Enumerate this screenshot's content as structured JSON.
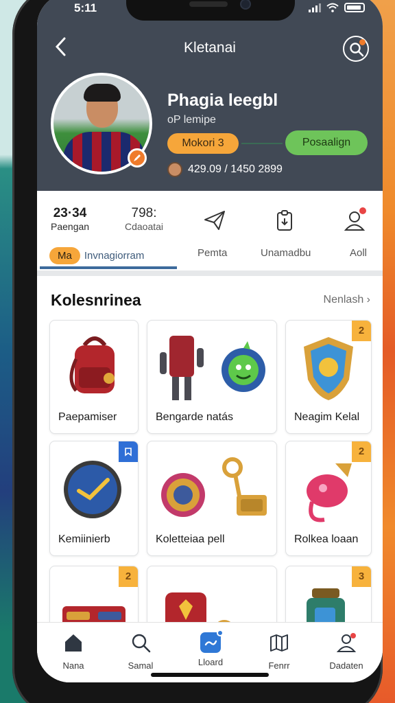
{
  "status": {
    "time": "5:11"
  },
  "header": {
    "title": "Kletanai",
    "back_icon": "chevron-left-icon",
    "search_icon": "search-icon"
  },
  "profile": {
    "name": "Phagia leegbl",
    "subtitle": "oP lemipe",
    "level": "Mokori 3",
    "action": "Posaalign",
    "stats": "429.09 / 1450 2899"
  },
  "top_stats": [
    {
      "num": "23·34",
      "label": "Paengan"
    },
    {
      "num": "798:",
      "label": "Cdaoatai"
    }
  ],
  "tabs": {
    "active_badge": "Ma",
    "active": "Invnagiorram",
    "items": [
      "Pemta",
      "Unamadbu",
      "Aoll"
    ]
  },
  "section": {
    "title": "Kolesnrinea",
    "see_all": "Nenlash"
  },
  "items": [
    {
      "label": "Paepamiser",
      "badge": ""
    },
    {
      "label": "Bengarde natás",
      "badge": ""
    },
    {
      "label": "Neagim Kelal",
      "badge": "2"
    },
    {
      "label": "Kemiinierb",
      "badge": ""
    },
    {
      "label": "Koletteiaa pell",
      "badge": ""
    },
    {
      "label": "Rolkea loaan",
      "badge": "2"
    },
    {
      "label": "",
      "badge": "2"
    },
    {
      "label": "",
      "badge": ""
    },
    {
      "label": "",
      "badge": "3"
    }
  ],
  "nav": [
    {
      "label": "Nana",
      "icon": "home-icon"
    },
    {
      "label": "Samal",
      "icon": "search-icon"
    },
    {
      "label": "Lloard",
      "icon": "chat-icon"
    },
    {
      "label": "Fenrr",
      "icon": "map-icon"
    },
    {
      "label": "Dadaten",
      "icon": "profile-icon"
    }
  ],
  "colors": {
    "header_bg": "#414955",
    "accent_orange": "#f6a63a",
    "accent_green": "#6ec45a",
    "accent_blue": "#2f78d6"
  }
}
